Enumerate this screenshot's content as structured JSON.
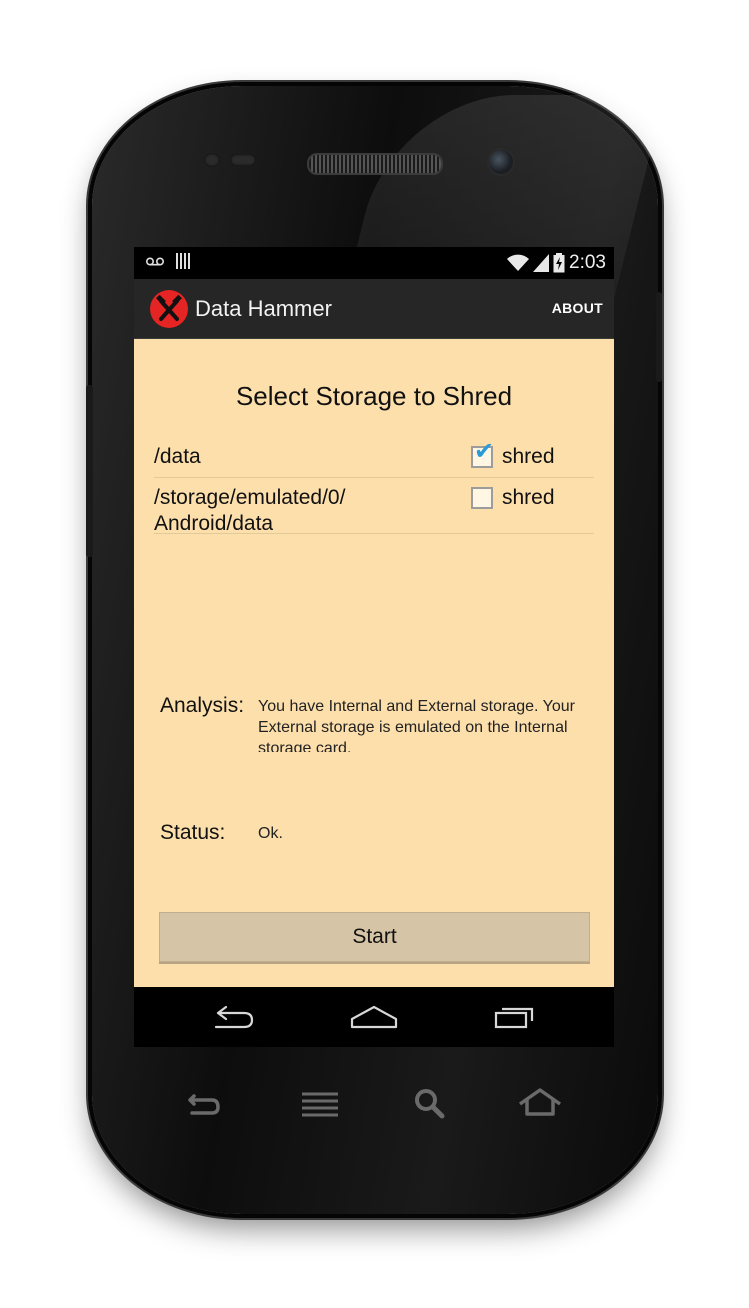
{
  "statusbar": {
    "time": "2:03",
    "icons": [
      "voicemail-icon",
      "signal-bars-icon",
      "wifi-icon",
      "cell-signal-icon",
      "battery-charging-icon"
    ]
  },
  "actionbar": {
    "app_title": "Data Hammer",
    "about_label": "ABOUT",
    "app_icon": "hammer-cross-icon"
  },
  "main": {
    "heading": "Select Storage to Shred",
    "storage_rows": [
      {
        "path": "/data",
        "checkbox_label": "shred",
        "checked": true
      },
      {
        "path_line1": "/storage/emulated/0/",
        "path_line2": "Android/data",
        "checkbox_label": "shred",
        "checked": false
      }
    ],
    "analysis_label": "Analysis:",
    "analysis_text": "You have Internal and External storage. Your External storage is emulated on the Internal storage card.",
    "status_label": "Status:",
    "status_text": "Ok.",
    "start_label": "Start"
  },
  "navbar": {
    "buttons": [
      "back-icon",
      "home-icon",
      "recents-icon"
    ]
  },
  "hardware_keys": [
    "back-icon",
    "menu-icon",
    "search-icon",
    "home-icon"
  ],
  "colors": {
    "content_bg": "#fddfac",
    "actionbar_bg": "#262626",
    "app_icon_red": "#e52424",
    "checkbox_blue": "#2a9bd6",
    "button_bg": "#d6c4a6"
  }
}
